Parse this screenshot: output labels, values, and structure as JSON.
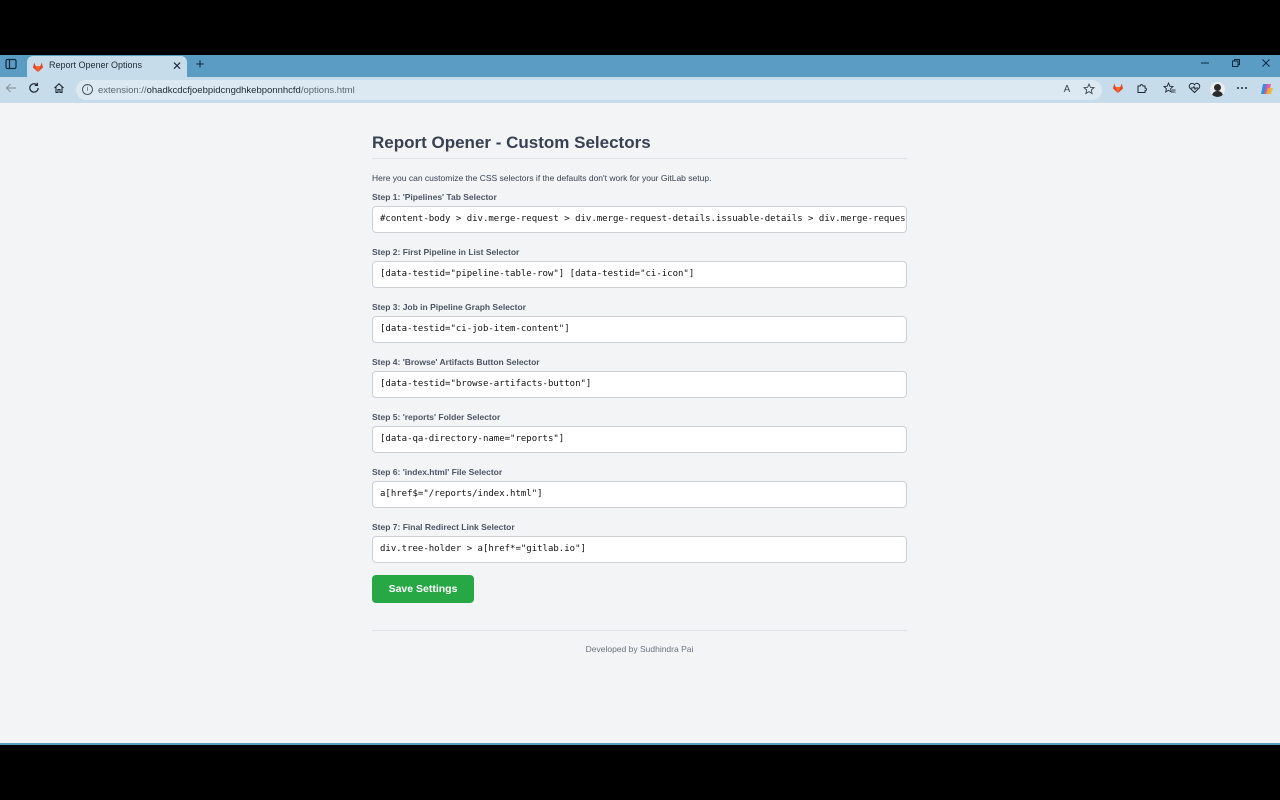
{
  "browser": {
    "tab_title": "Report Opener Options",
    "new_tab_glyph": "+",
    "close_glyph": "✕",
    "url_scheme": "extension://",
    "url_host": "ohadkcdcfjoebpidcngdhkebponnhcfd",
    "url_path": "/options.html",
    "read_aloud_glyph": "A",
    "icons": [
      "tab-actions-icon",
      "back-icon",
      "refresh-icon",
      "home-icon",
      "site-info-icon",
      "read-aloud-icon",
      "favorite-star-icon",
      "gitlab-extension-icon",
      "extensions-icon",
      "favorites-icon",
      "browser-essentials-icon",
      "profile-avatar",
      "more-menu-icon",
      "copilot-icon"
    ]
  },
  "page": {
    "title": "Report Opener - Custom Selectors",
    "description": "Here you can customize the CSS selectors if the defaults don't work for your GitLab setup.",
    "fields": [
      {
        "label": "Step 1: 'Pipelines' Tab Selector",
        "value": "#content-body > div.merge-request > div.merge-request-details.issuable-details > div.merge-request-st"
      },
      {
        "label": "Step 2: First Pipeline in List Selector",
        "value": "[data-testid=\"pipeline-table-row\"] [data-testid=\"ci-icon\"]"
      },
      {
        "label": "Step 3: Job in Pipeline Graph Selector",
        "value": "[data-testid=\"ci-job-item-content\"]"
      },
      {
        "label": "Step 4: 'Browse' Artifacts Button Selector",
        "value": "[data-testid=\"browse-artifacts-button\"]"
      },
      {
        "label": "Step 5: 'reports' Folder Selector",
        "value": "[data-qa-directory-name=\"reports\"]"
      },
      {
        "label": "Step 6: 'index.html' File Selector",
        "value": "a[href$=\"/reports/index.html\"]"
      },
      {
        "label": "Step 7: Final Redirect Link Selector",
        "value": "div.tree-holder > a[href*=\"gitlab.io\"]"
      }
    ],
    "save_label": "Save Settings",
    "footer": "Developed by Sudhindra Pai"
  },
  "colors": {
    "tab_strip": "#5a9cc4",
    "toolbar": "#c7dcea",
    "page_bg": "#f3f4f6",
    "save_button": "#28a745",
    "gitlab_orange": "#e2432a"
  }
}
